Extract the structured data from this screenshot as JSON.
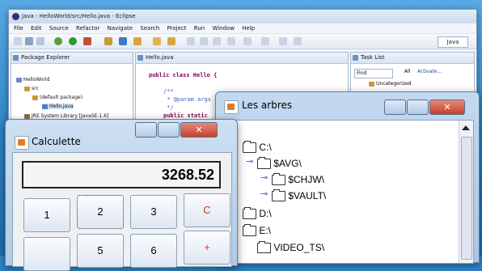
{
  "eclipse": {
    "title": "Java - HelloWorld/src/Hello.java - Eclipse",
    "menu": [
      "File",
      "Edit",
      "Source",
      "Refactor",
      "Navigate",
      "Search",
      "Project",
      "Run",
      "Window",
      "Help"
    ],
    "perspective": "Java",
    "package_explorer": {
      "title": "Package Explorer",
      "items": [
        "HelloWorld",
        "src",
        "(default package)",
        "Hello.java",
        "JRE System Library [JavaSE-1.6]"
      ]
    },
    "editor": {
      "tab": "Hello.java",
      "lines": [
        "public class Hello {",
        "/**",
        " * @param args",
        " */",
        "public static"
      ]
    },
    "task_list": {
      "title": "Task List",
      "find": "Find",
      "all": "All",
      "activate": "Activate...",
      "category": "Uncategorized"
    }
  },
  "arbres": {
    "title": "Les arbres",
    "nodes": [
      "C:\\",
      "$AVG\\",
      "$CHJW\\",
      "$VAULT\\",
      "D:\\",
      "E:\\",
      "VIDEO_TS\\"
    ]
  },
  "calc": {
    "title": "Calculette",
    "display": "3268.52",
    "keys": [
      "1",
      "2",
      "3",
      "C",
      "+",
      "5",
      "6"
    ]
  },
  "colors": {
    "accent": "#2f86c9",
    "clear": "#e0301a"
  }
}
